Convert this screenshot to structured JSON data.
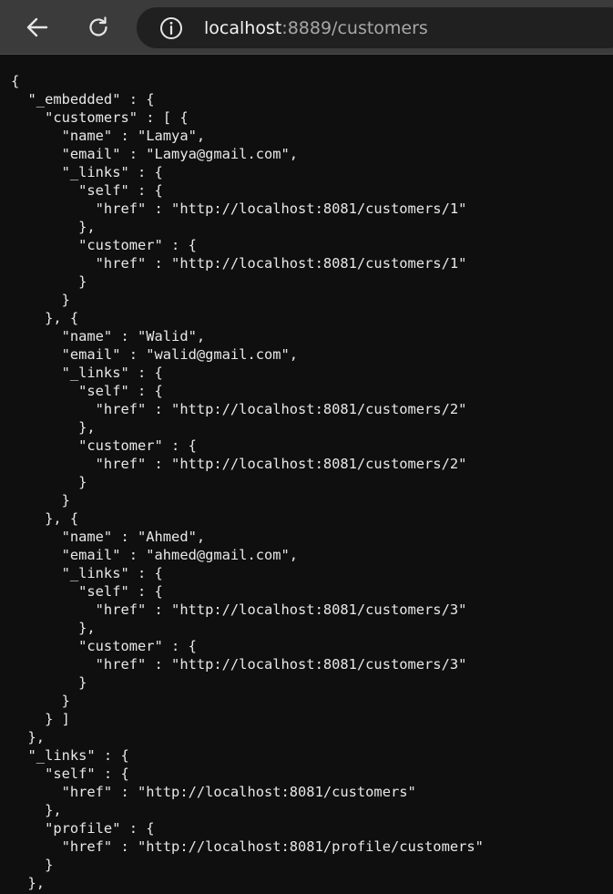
{
  "browser": {
    "url_host": "localhost",
    "url_rest": ":8889/customers"
  },
  "icons": {
    "back": "back-arrow-icon",
    "reload": "reload-icon",
    "info": "info-icon"
  },
  "colors": {
    "toolbar": "#3b3b3b",
    "address_bar": "#202020",
    "page_background": "#0f0f0f",
    "text": "#e8e8e8"
  },
  "json_lines": [
    "{",
    "  \"_embedded\" : {",
    "    \"customers\" : [ {",
    "      \"name\" : \"Lamya\",",
    "      \"email\" : \"Lamya@gmail.com\",",
    "      \"_links\" : {",
    "        \"self\" : {",
    "          \"href\" : \"http://localhost:8081/customers/1\"",
    "        },",
    "        \"customer\" : {",
    "          \"href\" : \"http://localhost:8081/customers/1\"",
    "        }",
    "      }",
    "    }, {",
    "      \"name\" : \"Walid\",",
    "      \"email\" : \"walid@gmail.com\",",
    "      \"_links\" : {",
    "        \"self\" : {",
    "          \"href\" : \"http://localhost:8081/customers/2\"",
    "        },",
    "        \"customer\" : {",
    "          \"href\" : \"http://localhost:8081/customers/2\"",
    "        }",
    "      }",
    "    }, {",
    "      \"name\" : \"Ahmed\",",
    "      \"email\" : \"ahmed@gmail.com\",",
    "      \"_links\" : {",
    "        \"self\" : {",
    "          \"href\" : \"http://localhost:8081/customers/3\"",
    "        },",
    "        \"customer\" : {",
    "          \"href\" : \"http://localhost:8081/customers/3\"",
    "        }",
    "      }",
    "    } ]",
    "  },",
    "  \"_links\" : {",
    "    \"self\" : {",
    "      \"href\" : \"http://localhost:8081/customers\"",
    "    },",
    "    \"profile\" : {",
    "      \"href\" : \"http://localhost:8081/profile/customers\"",
    "    }",
    "  },"
  ]
}
